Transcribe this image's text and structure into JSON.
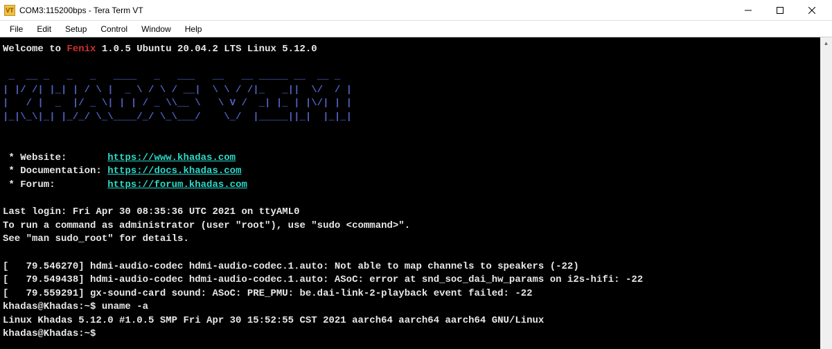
{
  "window": {
    "title": "COM3:115200bps - Tera Term VT",
    "icon_text": "VT"
  },
  "menu": {
    "file": "File",
    "edit": "Edit",
    "setup": "Setup",
    "control": "Control",
    "window": "Window",
    "help": "Help"
  },
  "terminal": {
    "welcome_prefix": "Welcome to ",
    "welcome_brand": "Fenix",
    "welcome_suffix": " 1.0.5 Ubuntu 20.04.2 LTS Linux 5.12.0",
    "ascii1": " _  __ _   _   _   ____   _   ___   __   __ _____ __  __ _ ",
    "ascii2": "| |/ /| |_| | / \\ |  _ \\ / \\ / __|  \\ \\ / /|_   _||  \\/  / |",
    "ascii3": "|   / |  _  |/ _ \\| | | / _ \\\\__ \\   \\ V /  _| |_ | |\\/| | |",
    "ascii4": "|_|\\_\\|_| |_/_/ \\_\\____/_/ \\_\\___/    \\_/  |_____||_|  |_|_|",
    "website_label": " * Website:       ",
    "website_url": "https://www.khadas.com",
    "docs_label": " * Documentation: ",
    "docs_url": "https://docs.khadas.com",
    "forum_label": " * Forum:         ",
    "forum_url": "https://forum.khadas.com",
    "last_login": "Last login: Fri Apr 30 08:35:36 UTC 2021 on ttyAML0",
    "sudo_hint1": "To run a command as administrator (user \"root\"), use \"sudo <command>\".",
    "sudo_hint2": "See \"man sudo_root\" for details.",
    "log1": "[   79.546270] hdmi-audio-codec hdmi-audio-codec.1.auto: Not able to map channels to speakers (-22)",
    "log2": "[   79.549438] hdmi-audio-codec hdmi-audio-codec.1.auto: ASoC: error at snd_soc_dai_hw_params on i2s-hifi: -22",
    "log3": "[   79.559291] gx-sound-card sound: ASoC: PRE_PMU: be.dai-link-2-playback event failed: -22",
    "prompt1_user": "khadas@Khadas",
    "prompt1_path": ":~$ ",
    "cmd1": "uname -a",
    "uname_out": "Linux Khadas 5.12.0 #1.0.5 SMP Fri Apr 30 15:52:55 CST 2021 aarch64 aarch64 aarch64 GNU/Linux",
    "prompt2_user": "khadas@Khadas",
    "prompt2_path": ":~$ "
  }
}
